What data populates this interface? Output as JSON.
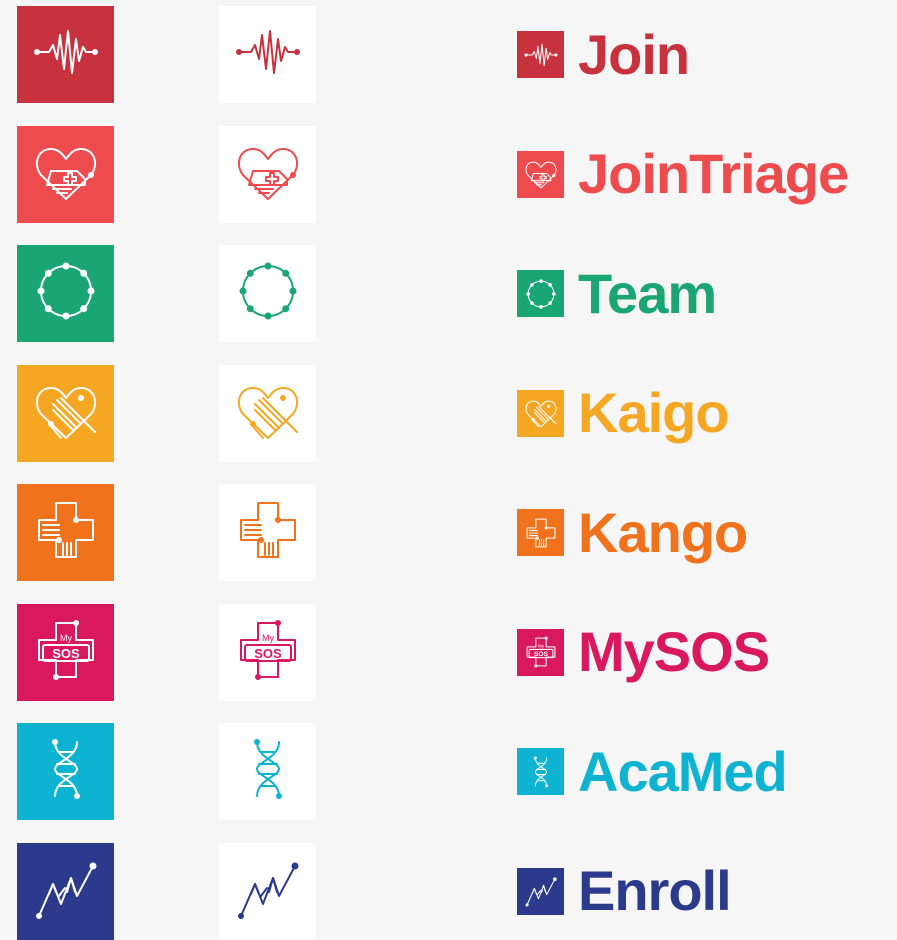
{
  "apps": [
    {
      "id": "join",
      "name": "Join",
      "color": "#c8323e",
      "icon": "pulse-icon"
    },
    {
      "id": "jointriage",
      "name": "JoinTriage",
      "color": "#ed4b4e",
      "icon": "heart-ambulance-icon"
    },
    {
      "id": "team",
      "name": "Team",
      "color": "#19a574",
      "icon": "dotted-circle-icon"
    },
    {
      "id": "kaigo",
      "name": "Kaigo",
      "color": "#f5a623",
      "icon": "heart-spool-icon"
    },
    {
      "id": "kango",
      "name": "Kango",
      "color": "#f0721d",
      "icon": "cross-bandage-icon"
    },
    {
      "id": "mysos",
      "name": "MySOS",
      "color": "#d9185e",
      "icon": "mysos-cross-icon",
      "icon_text_top": "My",
      "icon_text_bottom": "SOS"
    },
    {
      "id": "acamed",
      "name": "AcaMed",
      "color": "#0eb3d1",
      "icon": "dna-icon"
    },
    {
      "id": "enroll",
      "name": "Enroll",
      "color": "#2b3a8a",
      "icon": "growth-chart-icon"
    }
  ]
}
